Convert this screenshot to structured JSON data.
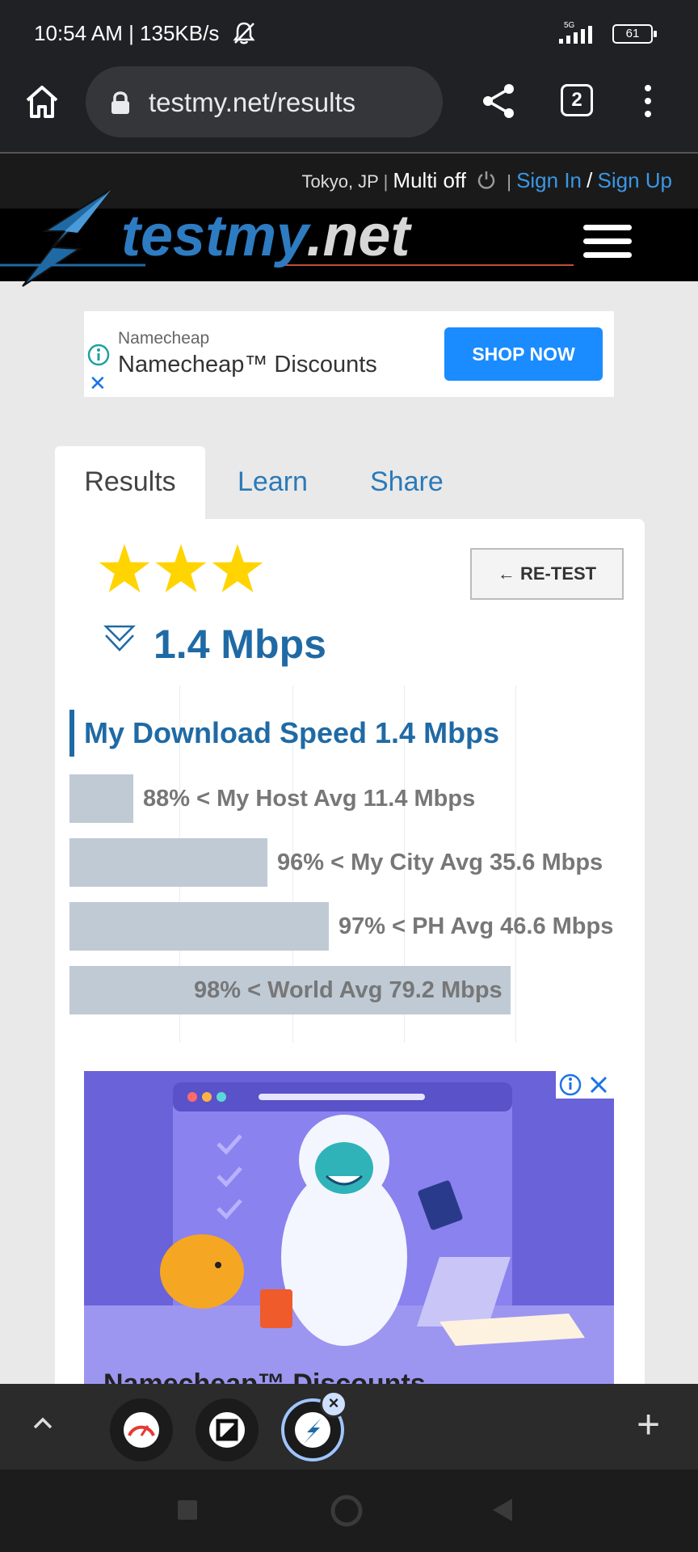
{
  "status_bar": {
    "time_speed": "10:54 AM | 135KB/s",
    "network": "5G",
    "battery": "61",
    "icons": [
      "bell-off-icon",
      "signal-icon",
      "battery-icon"
    ]
  },
  "browser": {
    "url": "testmy.net/results",
    "tab_count": "2",
    "icons": [
      "home-icon",
      "lock-icon",
      "share-icon",
      "tab-switcher-icon",
      "more-menu-icon"
    ]
  },
  "site_topbar": {
    "location": "Tokyo, JP",
    "multi": "Multi off",
    "sign_in": "Sign In",
    "separator_slash": "/",
    "sign_up": "Sign Up"
  },
  "header": {
    "logo_testmy": "testmy",
    "logo_net": ".net"
  },
  "ad_top": {
    "brand": "Namecheap",
    "title": "Namecheap™ Discounts",
    "cta": "SHOP NOW"
  },
  "tabs": [
    {
      "label": "Results",
      "active": true
    },
    {
      "label": "Learn",
      "active": false
    },
    {
      "label": "Share",
      "active": false
    }
  ],
  "result": {
    "stars": 3,
    "retest_label": "← RE-TEST",
    "speed": "1.4 Mbps"
  },
  "chart_data": {
    "type": "bar",
    "title": "My Download Speed 1.4 Mbps",
    "categories": [
      "My Host Avg",
      "My City Avg",
      "PH Avg",
      "World Avg"
    ],
    "values": [
      11.4,
      35.6,
      46.6,
      79.2
    ],
    "bar_labels": [
      "88% < My Host Avg 11.4 Mbps",
      "96% < My City Avg 35.6 Mbps",
      "97% < PH Avg 46.6 Mbps",
      "98% < World Avg 79.2 Mbps"
    ],
    "xlim": [
      0,
      79.2
    ],
    "grid": true,
    "bar_color": "#bfcad5"
  },
  "ad_bottom": {
    "title": "Namecheap™ Discounts"
  },
  "bottom_bar": {
    "tab_icons": [
      "speedometer-icon",
      "app-icon",
      "lightning-icon"
    ],
    "close_label": "×",
    "plus_label": "+"
  },
  "colors": {
    "accent_blue": "#1f6aa5",
    "link_blue": "#3a97e6",
    "cta_blue": "#1a8cff",
    "star_yellow": "#ffd400"
  }
}
